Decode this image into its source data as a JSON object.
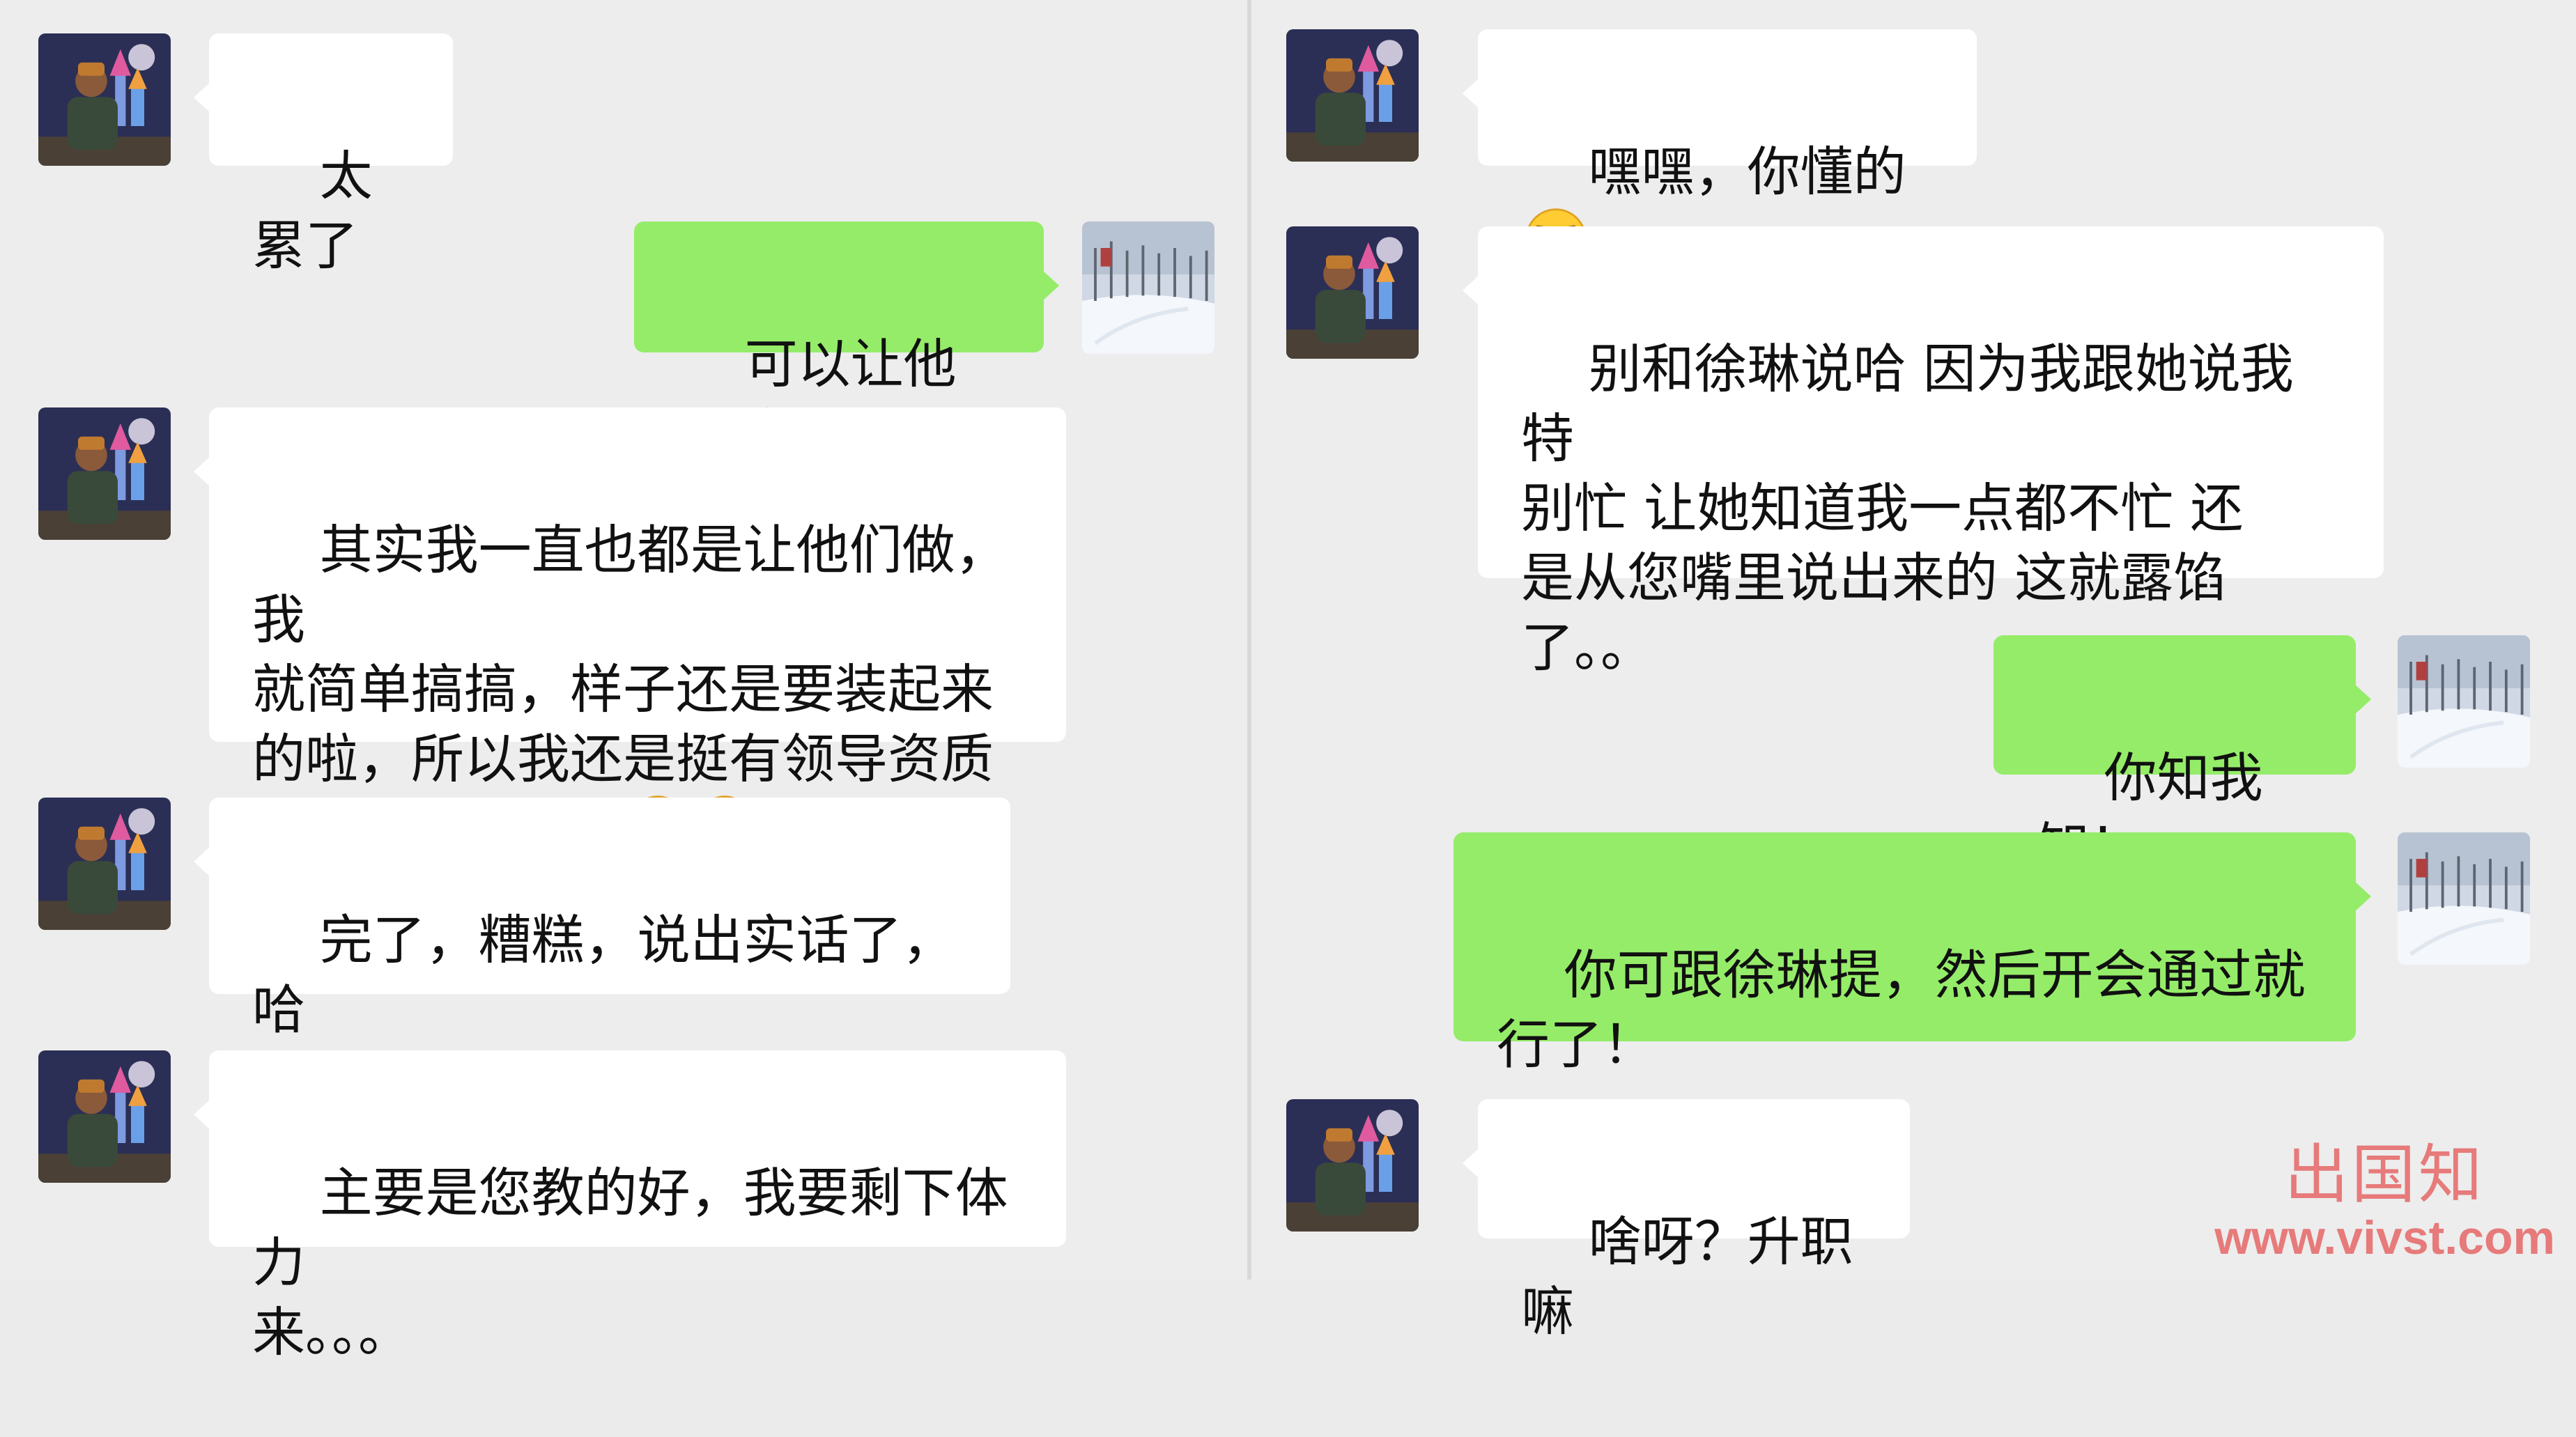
{
  "left_messages": [
    {
      "side": "in",
      "text": "太累了"
    },
    {
      "side": "out",
      "text": "可以让他们做"
    },
    {
      "side": "in",
      "text": "其实我一直也都是让他们做，我\n就简单搞搞，样子还是要装起来\n的啦，所以我还是挺有领导资质\n的，是不是呀！",
      "emoji": [
        "smirk-emoji",
        "smirk-emoji"
      ]
    },
    {
      "side": "in",
      "text": "完了，糟糕，说出实话了，哈\n哈，我想您也不会怪我的哈！"
    },
    {
      "side": "in",
      "text": "主要是您教的好，我要剩下体力\n来。。。"
    }
  ],
  "right_messages": [
    {
      "side": "in",
      "text": "嘿嘿，你懂的",
      "emoji": [
        "smirk-emoji"
      ]
    },
    {
      "side": "in",
      "text": "别和徐琳说哈 因为我跟她说我特\n别忙 让她知道我一点都不忙 还\n是从您嘴里说出来的 这就露馅\n了。。"
    },
    {
      "side": "out",
      "text": "你知我知！"
    },
    {
      "side": "out",
      "text": "你可跟徐琳提，然后开会通过就\n行了！"
    },
    {
      "side": "in",
      "text": "啥呀？升职嘛"
    }
  ],
  "watermark": {
    "logo": "出国知",
    "url": "www.vivst.com"
  },
  "colors": {
    "outgoing_bubble": "#95ec69",
    "incoming_bubble": "#ffffff",
    "background": "#ededed"
  },
  "icons": {
    "incoming_avatar": "castle-avatar-icon",
    "outgoing_avatar": "snow-avatar-icon",
    "emoji": "smirk-emoji"
  }
}
